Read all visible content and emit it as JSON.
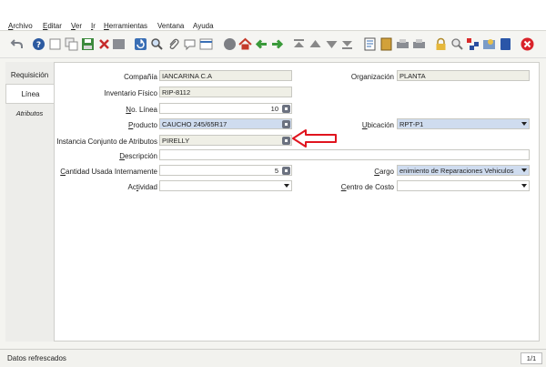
{
  "menu": [
    {
      "label": "Archivo",
      "mnemonic": "A",
      "rest": "rchivo"
    },
    {
      "label": "Editar",
      "mnemonic": "E",
      "rest": "ditar"
    },
    {
      "label": "Ver",
      "mnemonic": "V",
      "rest": "er"
    },
    {
      "label": "Ir",
      "mnemonic": "I",
      "rest": "r"
    },
    {
      "label": "Herramientas",
      "mnemonic": "H",
      "rest": "erramientas"
    },
    {
      "label": "Ventana",
      "mnemonic": "",
      "rest": "Ventana"
    },
    {
      "label": "Ayuda",
      "mnemonic": "",
      "rest": "Ayuda"
    }
  ],
  "tabs": {
    "requisicion": "Requisición",
    "linea": "Línea",
    "atributos": "Atributos"
  },
  "form": {
    "compania": {
      "label": "Compañía",
      "value": "IANCARINA C.A"
    },
    "organizacion": {
      "label": "Organización",
      "value": "PLANTA"
    },
    "inventario": {
      "label": "Inventario Físico",
      "value": "RIP-8112"
    },
    "no_linea": {
      "label_mn": "N",
      "label_rest": "o. Línea",
      "value": "10"
    },
    "producto": {
      "label_mn": "P",
      "label_rest": "roducto",
      "value": "CAUCHO 245/65R17"
    },
    "ubicacion": {
      "label_mn": "U",
      "label_rest": "bicación",
      "value": "RPT-P1"
    },
    "instancia": {
      "label": "Instancia Conjunto de Atributos",
      "value": "PIRELLY"
    },
    "descripcion": {
      "label_mn": "D",
      "label_rest": "escripción",
      "value": ""
    },
    "cantidad": {
      "label_mn": "C",
      "label_rest": "antidad Usada Internamente",
      "value": "5"
    },
    "cargo": {
      "label_mn": "C",
      "label_rest": "argo",
      "value": "enimiento de Reparaciones Vehiculos"
    },
    "actividad": {
      "label_pre": "Ac",
      "label_mn": "t",
      "label_rest": "ividad",
      "value": ""
    },
    "centro": {
      "label_pre": "",
      "label_mn": "C",
      "label_rest": "entro de Costo",
      "value": ""
    }
  },
  "status": {
    "text": "Datos refrescados",
    "page": "1/1"
  },
  "colors": {
    "required_field": "#cfdcef",
    "readonly_field": "#efefe6",
    "annotation_arrow": "#e0141e",
    "close_button": "#d9232a"
  }
}
